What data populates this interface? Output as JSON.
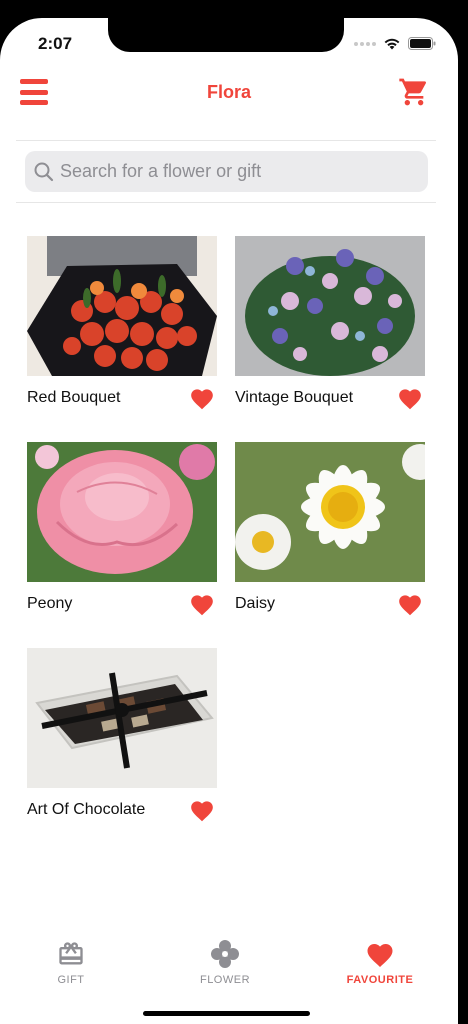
{
  "status": {
    "time": "2:07"
  },
  "header": {
    "title": "Flora"
  },
  "search": {
    "placeholder": "Search for a flower or gift"
  },
  "products": [
    {
      "name": "Red Bouquet",
      "favourite": true
    },
    {
      "name": "Vintage Bouquet",
      "favourite": true
    },
    {
      "name": "Peony",
      "favourite": true
    },
    {
      "name": "Daisy",
      "favourite": true
    },
    {
      "name": "Art Of Chocolate",
      "favourite": true
    }
  ],
  "tabs": [
    {
      "label": "GIFT",
      "icon": "gift-icon",
      "active": false
    },
    {
      "label": "FLOWER",
      "icon": "flower-icon",
      "active": false
    },
    {
      "label": "FAVOURITE",
      "icon": "heart-icon",
      "active": true
    }
  ],
  "colors": {
    "accent": "#f0453b",
    "inactive": "#8e8e93",
    "search_bg": "#ebebed"
  }
}
